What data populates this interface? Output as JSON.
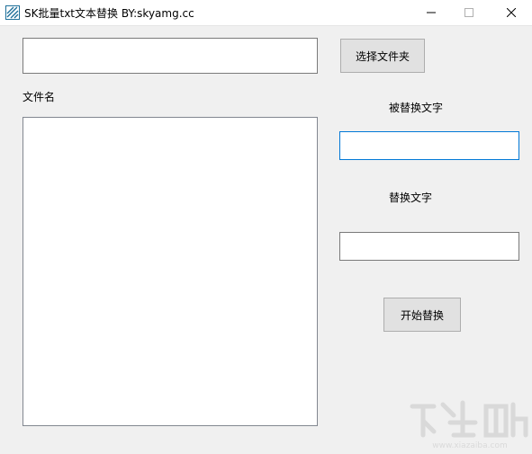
{
  "window": {
    "title": "SK批量txt文本替换 BY:skyamg.cc"
  },
  "folder": {
    "path_value": "",
    "choose_button_label": "选择文件夹"
  },
  "file_list": {
    "label": "文件名",
    "items": []
  },
  "find": {
    "label": "被替换文字",
    "value": ""
  },
  "replace": {
    "label": "替换文字",
    "value": ""
  },
  "actions": {
    "start_button_label": "开始替换"
  },
  "icons": {
    "app": "app-icon",
    "minimize": "minimize-icon",
    "maximize": "maximize-icon",
    "close": "close-icon"
  },
  "colors": {
    "window_bg": "#f0f0f0",
    "focus_border": "#0078d7",
    "button_bg": "#e1e1e1"
  }
}
